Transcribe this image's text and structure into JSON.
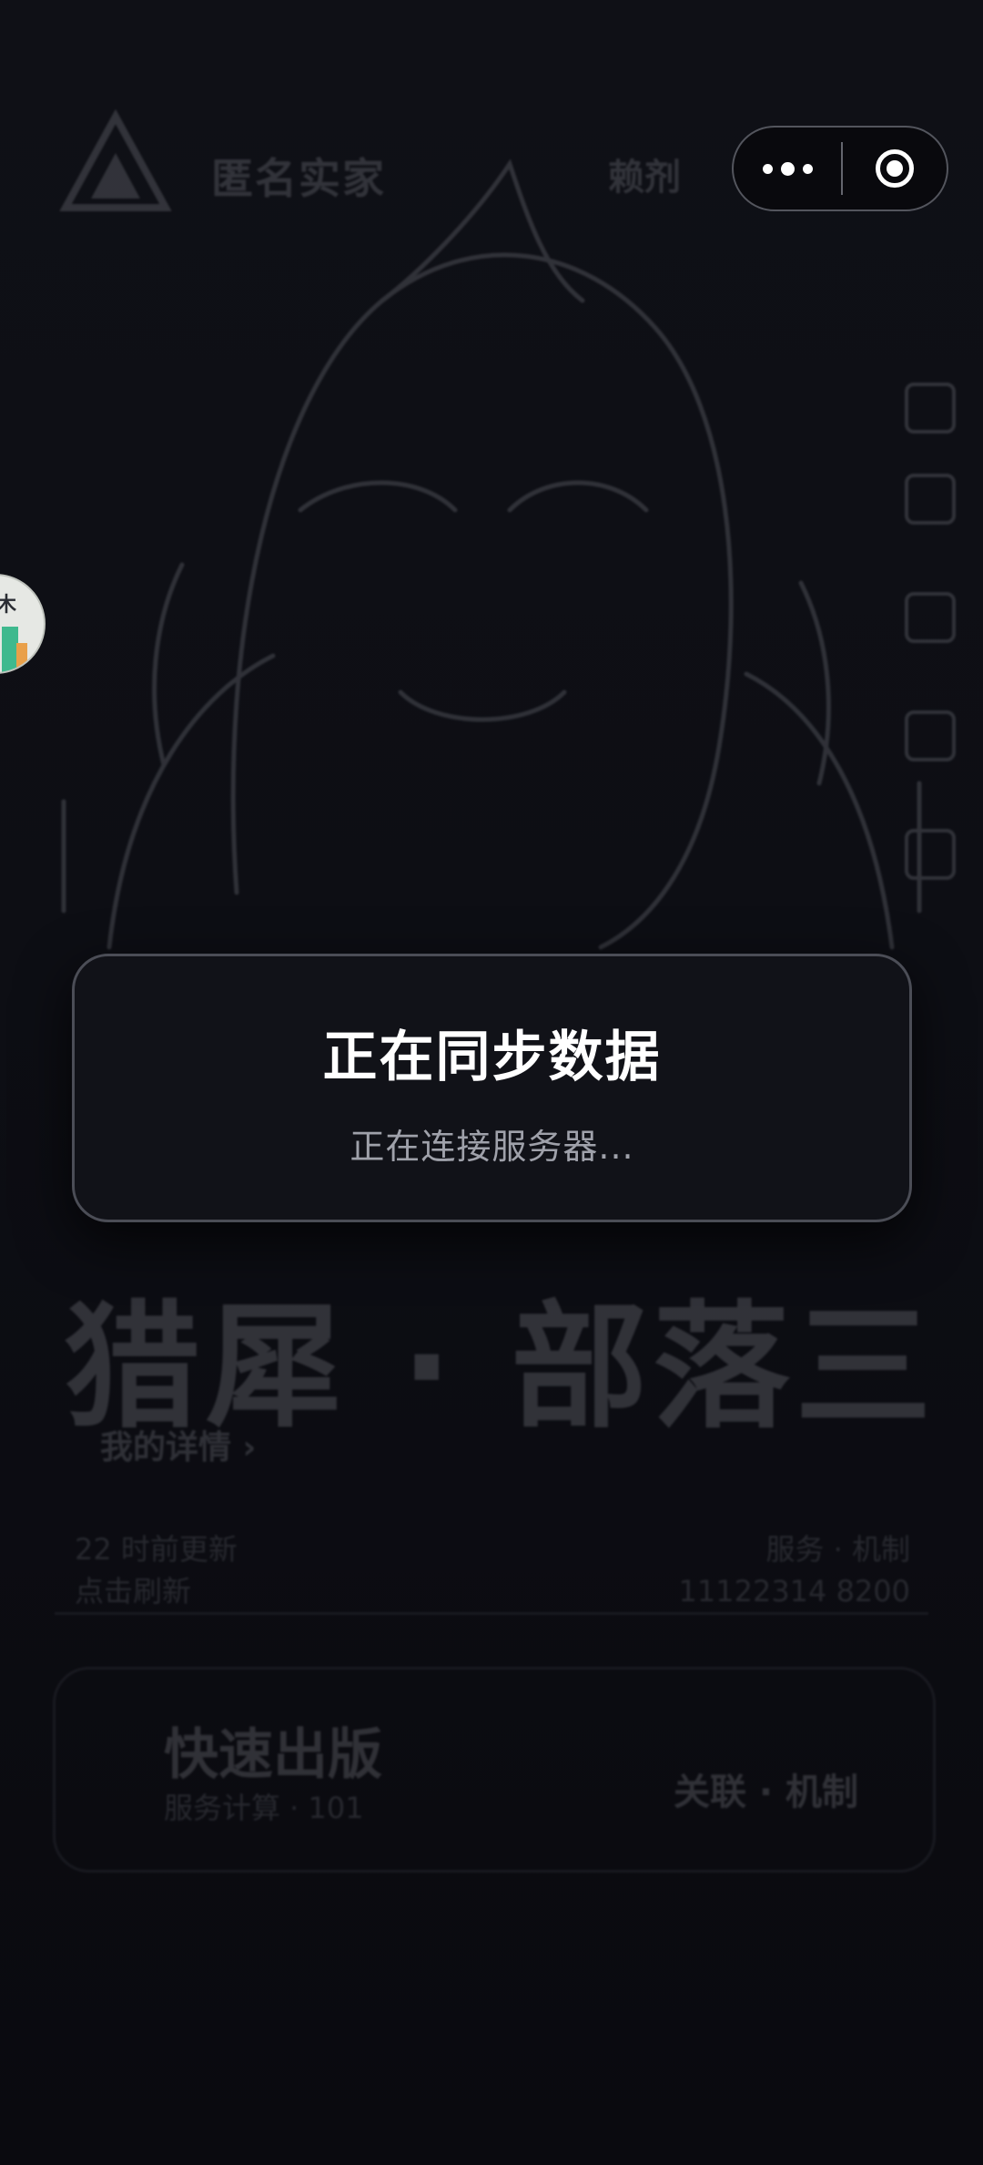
{
  "background": {
    "app_name": "匿名实家",
    "header_right": "赖剂",
    "hero_title": "猎犀 · 部落三",
    "link_label": "我的详情 ›",
    "meta_left": [
      "22 时前更新",
      "点击刷新"
    ],
    "meta_right": [
      "服务 · 机制",
      "11122314 8200"
    ],
    "card": {
      "title": "快速出版",
      "subtitle": "服务计算 · 101",
      "right_label": "关联 · 机制"
    }
  },
  "capsule": {
    "more_icon": "more-dots-icon",
    "close_icon": "close-circle-icon"
  },
  "floating_avatar": {
    "text": "木"
  },
  "sync_dialog": {
    "title": "正在同步数据",
    "subtitle": "正在连接服务器..."
  },
  "colors": {
    "background": "#0b0b10",
    "dialog_bg": "#111218",
    "dialog_border": "#4b4d56",
    "title": "#ffffff",
    "subtitle": "#9fa1aa"
  }
}
